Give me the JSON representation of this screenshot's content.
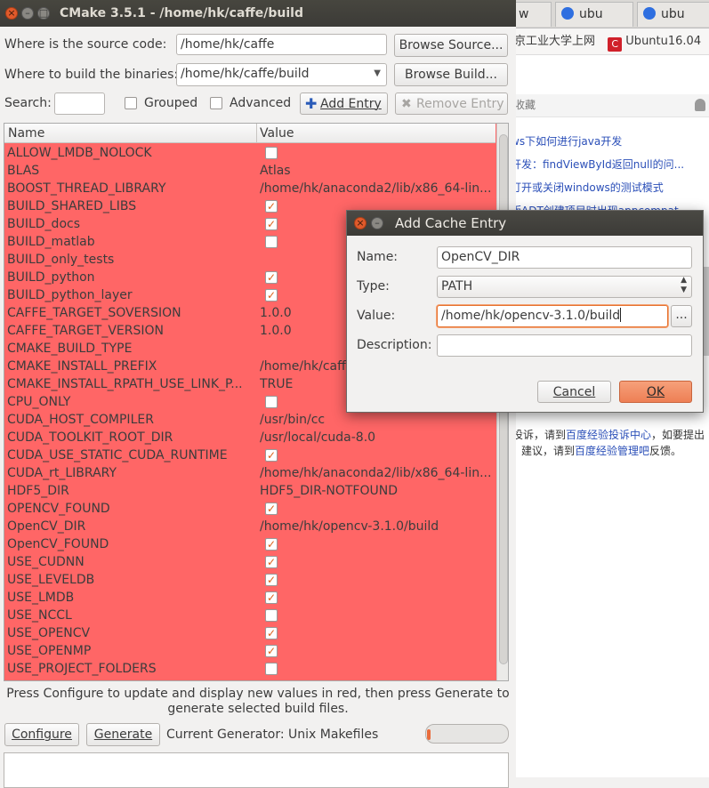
{
  "browser": {
    "tabs": [
      "w",
      "ubu",
      "ubu"
    ],
    "bookmarks": [
      "京工业大学上网",
      "Ubuntu16.04"
    ],
    "bookmark_bar2": "收藏",
    "links": [
      "ws下如何进行java开发",
      "开发：findViewById返回null的问...",
      "打开或关闭windows的测试模式",
      "版ADT创建项目时出现appcompat..."
    ],
    "footer_line1_prefix": "投诉，请到",
    "footer_line1_link": "百度经验投诉中心",
    "footer_line1_suffix": "，如要提出",
    "footer_line2_prefix": "建议，请到",
    "footer_line2_link": "百度经验管理吧",
    "footer_line2_suffix": "反馈。"
  },
  "window": {
    "title": "CMake 3.5.1 - /home/hk/caffe/build"
  },
  "form": {
    "source_label": "Where is the source code:",
    "source_value": "/home/hk/caffe",
    "browse_source": "Browse Source...",
    "build_label": "Where to build the binaries:",
    "build_value": "/home/hk/caffe/build",
    "browse_build": "Browse Build...",
    "search_label": "Search:",
    "search_value": "",
    "grouped_label": "Grouped",
    "advanced_label": "Advanced",
    "add_entry": "Add Entry",
    "remove_entry": "Remove Entry"
  },
  "table": {
    "headers": [
      "Name",
      "Value"
    ],
    "rows": [
      {
        "name": "ALLOW_LMDB_NOLOCK",
        "value": "",
        "checkbox": true,
        "checked": false
      },
      {
        "name": "BLAS",
        "value": "Atlas",
        "checkbox": false,
        "checked": false
      },
      {
        "name": "BOOST_THREAD_LIBRARY",
        "value": "/home/hk/anaconda2/lib/x86_64-lin...",
        "checkbox": false,
        "checked": false
      },
      {
        "name": "BUILD_SHARED_LIBS",
        "value": "",
        "checkbox": true,
        "checked": true
      },
      {
        "name": "BUILD_docs",
        "value": "",
        "checkbox": true,
        "checked": true
      },
      {
        "name": "BUILD_matlab",
        "value": "",
        "checkbox": true,
        "checked": false
      },
      {
        "name": "BUILD_only_tests",
        "value": "",
        "checkbox": false,
        "checked": false
      },
      {
        "name": "BUILD_python",
        "value": "",
        "checkbox": true,
        "checked": true
      },
      {
        "name": "BUILD_python_layer",
        "value": "",
        "checkbox": true,
        "checked": true
      },
      {
        "name": "CAFFE_TARGET_SOVERSION",
        "value": "1.0.0",
        "checkbox": false,
        "checked": false
      },
      {
        "name": "CAFFE_TARGET_VERSION",
        "value": "1.0.0",
        "checkbox": false,
        "checked": false
      },
      {
        "name": "CMAKE_BUILD_TYPE",
        "value": "",
        "checkbox": false,
        "checked": false
      },
      {
        "name": "CMAKE_INSTALL_PREFIX",
        "value": "/home/hk/caffe/build/install",
        "checkbox": false,
        "checked": false
      },
      {
        "name": "CMAKE_INSTALL_RPATH_USE_LINK_P...",
        "value": "TRUE",
        "checkbox": false,
        "checked": false
      },
      {
        "name": "CPU_ONLY",
        "value": "",
        "checkbox": true,
        "checked": false
      },
      {
        "name": "CUDA_HOST_COMPILER",
        "value": "/usr/bin/cc",
        "checkbox": false,
        "checked": false
      },
      {
        "name": "CUDA_TOOLKIT_ROOT_DIR",
        "value": "/usr/local/cuda-8.0",
        "checkbox": false,
        "checked": false
      },
      {
        "name": "CUDA_USE_STATIC_CUDA_RUNTIME",
        "value": "",
        "checkbox": true,
        "checked": true
      },
      {
        "name": "CUDA_rt_LIBRARY",
        "value": "/home/hk/anaconda2/lib/x86_64-lin...",
        "checkbox": false,
        "checked": false
      },
      {
        "name": "HDF5_DIR",
        "value": "HDF5_DIR-NOTFOUND",
        "checkbox": false,
        "checked": false
      },
      {
        "name": "OPENCV_FOUND",
        "value": "",
        "checkbox": true,
        "checked": true
      },
      {
        "name": "OpenCV_DIR",
        "value": "/home/hk/opencv-3.1.0/build",
        "checkbox": false,
        "checked": false
      },
      {
        "name": "OpenCV_FOUND",
        "value": "",
        "checkbox": true,
        "checked": true
      },
      {
        "name": "USE_CUDNN",
        "value": "",
        "checkbox": true,
        "checked": true
      },
      {
        "name": "USE_LEVELDB",
        "value": "",
        "checkbox": true,
        "checked": true
      },
      {
        "name": "USE_LMDB",
        "value": "",
        "checkbox": true,
        "checked": true
      },
      {
        "name": "USE_NCCL",
        "value": "",
        "checkbox": true,
        "checked": false
      },
      {
        "name": "USE_OPENCV",
        "value": "",
        "checkbox": true,
        "checked": true
      },
      {
        "name": "USE_OPENMP",
        "value": "",
        "checkbox": true,
        "checked": true
      },
      {
        "name": "USE_PROJECT_FOLDERS",
        "value": "",
        "checkbox": true,
        "checked": false
      }
    ]
  },
  "footer": {
    "hint_line1": "Press Configure to update and display new values in red, then press Generate to",
    "hint_line2": "generate selected build files.",
    "configure": "Configure",
    "generate": "Generate",
    "generator": "Current Generator: Unix Makefiles"
  },
  "dialog": {
    "title": "Add Cache Entry",
    "name_label": "Name:",
    "name_value": "OpenCV_DIR",
    "type_label": "Type:",
    "type_value": "PATH",
    "value_label": "Value:",
    "value_value": "/home/hk/opencv-3.1.0/build",
    "browse": "...",
    "description_label": "Description:",
    "description_value": "",
    "cancel": "Cancel",
    "ok": "OK"
  }
}
